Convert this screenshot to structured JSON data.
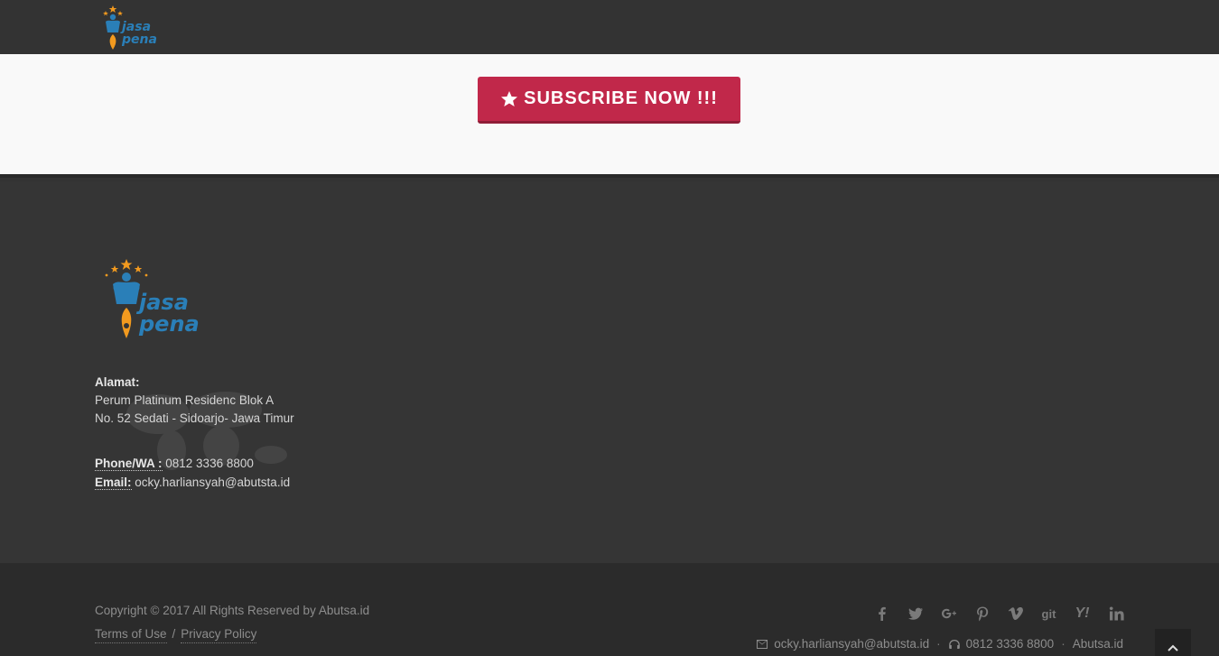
{
  "brand": {
    "name_line1": "jasa",
    "name_line2": "pena"
  },
  "subscribe": {
    "label": "SUBSCRIBE NOW !!!",
    "icon": "star-icon",
    "color": "#c1284a"
  },
  "address": {
    "label": "Alamat:",
    "line1": "Perum Platinum Residenc Blok A",
    "line2": "No. 52 Sedati - Sidoarjo- Jawa Timur"
  },
  "contact": {
    "phone_label": "Phone/WA :",
    "phone": "0812 3336 8800",
    "email_label": "Email:",
    "email": "ocky.harliansyah@abutsta.id"
  },
  "footer": {
    "copyright": "Copyright © 2017 All Rights Reserved by Abutsa.id",
    "terms": "Terms of Use",
    "separator": "/",
    "privacy": "Privacy Policy",
    "socials": [
      "facebook-icon",
      "twitter-icon",
      "google-plus-icon",
      "pinterest-icon",
      "vimeo-icon",
      "git-icon",
      "yahoo-icon",
      "linkedin-icon"
    ],
    "social_text": {
      "git": "git",
      "yahoo": "Y!"
    },
    "email": "ocky.harliansyah@abutsta.id",
    "phone": "0812 3336 8800",
    "site": "Abutsa.id",
    "dot": "·"
  }
}
